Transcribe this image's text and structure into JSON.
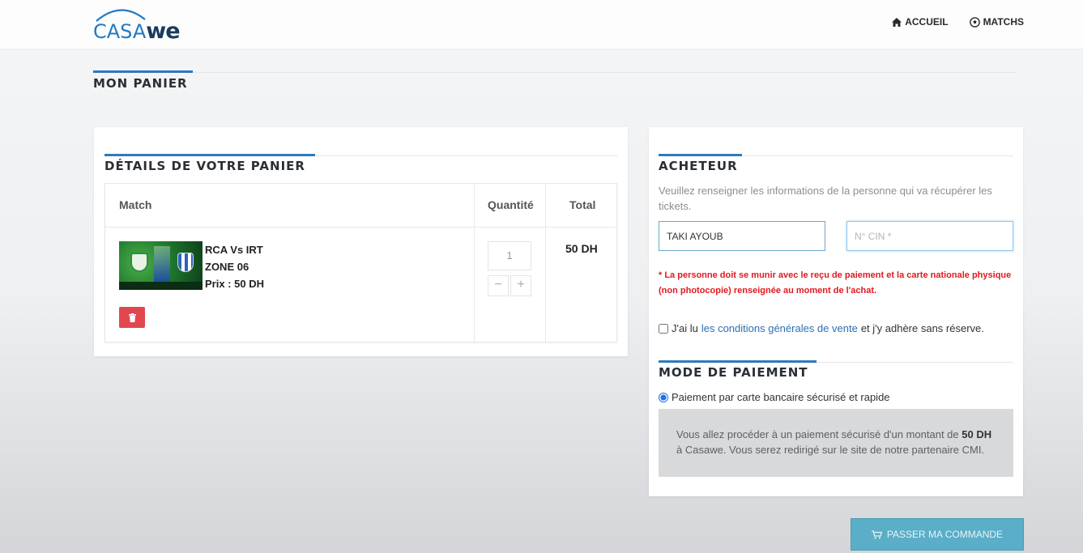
{
  "header": {
    "logo_part1": "CASA",
    "logo_part2": "we",
    "nav": [
      {
        "label": "ACCUEIL",
        "icon": "home-icon"
      },
      {
        "label": "MATCHS",
        "icon": "soccer-ball-icon"
      }
    ]
  },
  "page": {
    "title": "MON PANIER"
  },
  "cart": {
    "title": "DÉTAILS DE VOTRE PANIER",
    "columns": [
      "Match",
      "Quantité",
      "Total"
    ],
    "item": {
      "match": "RCA Vs IRT",
      "zone": "ZONE 06",
      "price": "Prix : 50 DH",
      "quantity": "1",
      "total": "50 DH",
      "qty_minus": "−",
      "qty_plus": "+"
    }
  },
  "buyer": {
    "title": "ACHETEUR",
    "description": "Veuillez renseigner les informations de la personne qui va récupérer les tickets.",
    "name_value": "TAKI AYOUB",
    "cin_placeholder": "N° CIN *",
    "warning": "* La personne doit se munir avec le reçu de paiement et la carte nationale physique (non photocopie) renseignée au moment de l'achat.",
    "terms_prefix": "J'ai lu",
    "terms_link": "les conditions générales de vente",
    "terms_suffix": "et j'y adhère sans réserve.",
    "terms_checked": false
  },
  "payment": {
    "title": "MODE DE PAIEMENT",
    "option": "Paiement par carte bancaire sécurisé et rapide",
    "info_before": "Vous allez procéder à un paiement sécurisé d'un montant de",
    "info_amount": "50 DH",
    "info_after": "à Casawe. Vous serez redirigé sur le site de notre partenaire CMI."
  },
  "order_button": {
    "label": "PASSER MA COMMANDE",
    "icon": "cart-icon"
  },
  "colors": {
    "accent": "#2d7bbd",
    "warning": "#e0191f",
    "delete": "#e2474f",
    "order_button": "#5aaec7"
  }
}
